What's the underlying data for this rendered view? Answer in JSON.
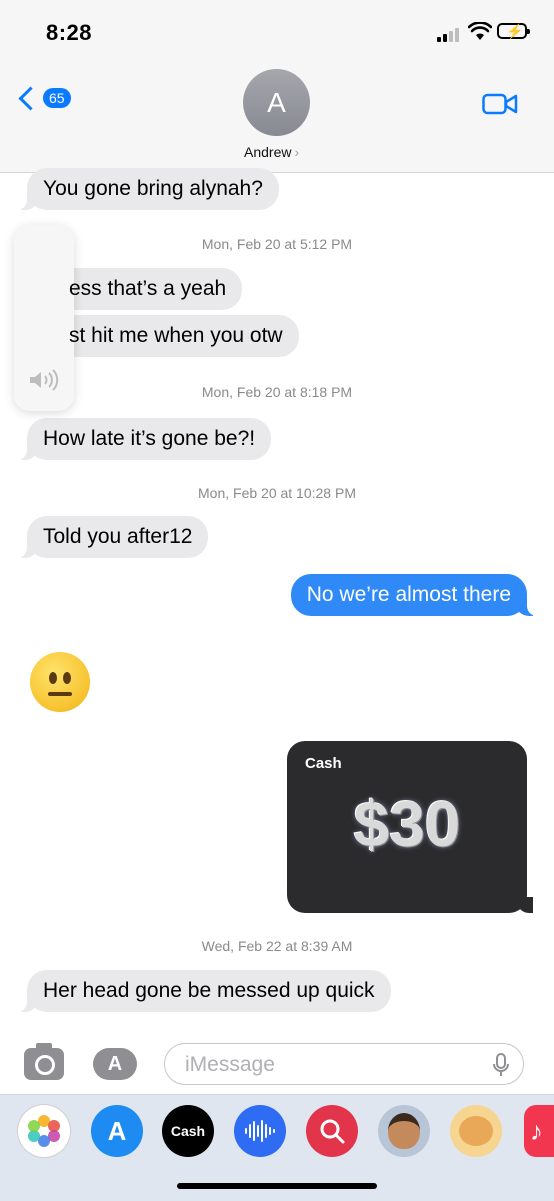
{
  "status_bar": {
    "time": "8:28"
  },
  "header": {
    "back_count": "65",
    "avatar_initial": "A",
    "contact_name": "Andrew",
    "contact_chevron": "›"
  },
  "messages": {
    "m1": "You gone bring alynah?",
    "ts1": "Mon, Feb 20 at 5:12 PM",
    "m2": "ess that’s a yeah",
    "m3": "st hit me when you otw",
    "ts2": "Mon, Feb 20 at 8:18 PM",
    "m4": "How late it’s gone be?!",
    "ts3": "Mon, Feb 20 at 10:28 PM",
    "m5": "Told you after12",
    "m6": "No we’re almost there",
    "emoji_name": "neutral-face",
    "cash_label": "Cash",
    "cash_amount": "$30",
    "ts4": "Wed, Feb 22 at 8:39 AM",
    "m7": "Her head gone be messed up quick"
  },
  "compose": {
    "placeholder": "iMessage"
  },
  "app_drawer": {
    "apple_cash_label": "Cash",
    "apps": [
      "photos",
      "app-store",
      "apple-cash",
      "audio-message",
      "search-images",
      "memoji",
      "animoji",
      "music"
    ]
  },
  "colors": {
    "sent_bubble": "#2f8af7",
    "received_bubble": "#e9e9eb",
    "accent": "#0a7aff"
  }
}
